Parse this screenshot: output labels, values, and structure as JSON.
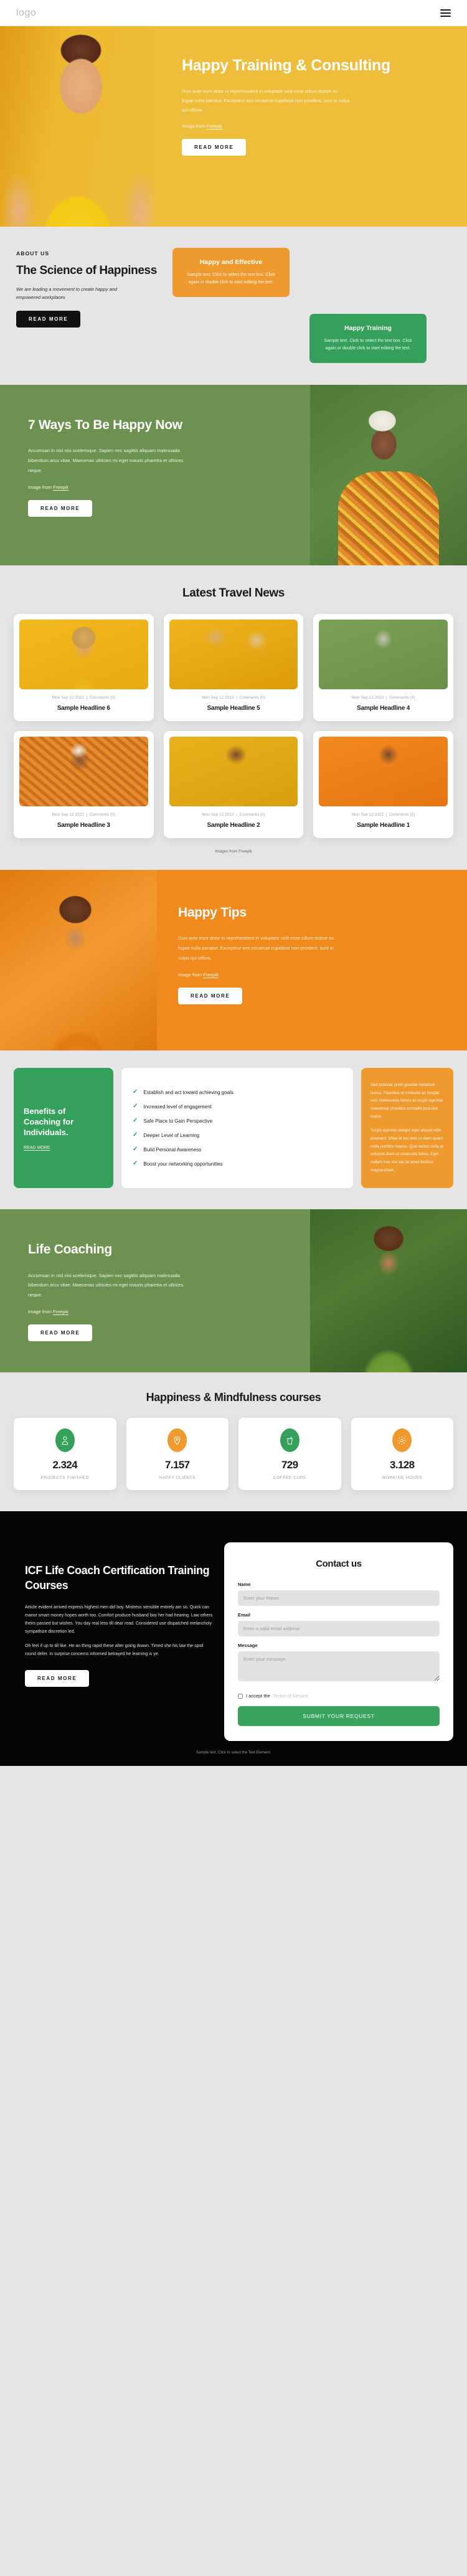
{
  "nav": {
    "logo": "logo",
    "menu_icon": "hamburger-icon"
  },
  "hero": {
    "title": "Happy Training & Consulting",
    "body": "Duis aute irure dolor in reprehenderit in voluptate velit esse cillum dolore eu fugiat nulla pariatur. Excepteur sint occaecat cupidatat non proident, sunt in culpa qui officia.",
    "credit_prefix": "Image from ",
    "credit_link": "Freepik",
    "cta": "READ MORE"
  },
  "about": {
    "eyebrow": "ABOUT US",
    "title": "The Science of Happiness",
    "subtitle": "We are leading a movement to create happy and empowered workplaces",
    "cta": "READ MORE",
    "cards": [
      {
        "title": "Happy and Effective",
        "body": "Sample text. Click to select the text box. Click again or double click to start editing the text.",
        "color": "#ee9a2e"
      },
      {
        "title": "Happy Training",
        "body": "Sample text. Click to select the text box. Click again or double click to start editing the text.",
        "color": "#34a05c"
      }
    ]
  },
  "seven_ways": {
    "title": "7 Ways To Be Happy Now",
    "body": "Accumsan in nisl nisi scelerisque. Sapien nec sagittis aliquam malesuada bibendum arcu vitae. Maecenas ultricies mi eget mauris pharetra et ultrices neque.",
    "credit_prefix": "Image from ",
    "credit_link": "Freepik",
    "cta": "READ MORE"
  },
  "news": {
    "title": "Latest Travel News",
    "credit": "Images from Freepik",
    "cards": [
      {
        "date": "Mon Sep 12 2022",
        "comments": "Comments (0)",
        "headline": "Sample Headline 6"
      },
      {
        "date": "Mon Sep 12 2022",
        "comments": "Comments (0)",
        "headline": "Sample Headline 5"
      },
      {
        "date": "Mon Sep 12 2022",
        "comments": "Comments (0)",
        "headline": "Sample Headline 4"
      },
      {
        "date": "Mon Sep 12 2022",
        "comments": "Comments (0)",
        "headline": "Sample Headline 3"
      },
      {
        "date": "Mon Sep 12 2022",
        "comments": "Comments (0)",
        "headline": "Sample Headline 2"
      },
      {
        "date": "Mon Sep 12 2022",
        "comments": "Comments (0)",
        "headline": "Sample Headline 1"
      }
    ]
  },
  "tips": {
    "title": "Happy Tips",
    "body": "Duis aute irure dolor in reprehenderit in voluptate velit esse cillum dolore eu fugiat nulla pariatur. Excepteur sint occaecat cupidatat non proident, sunt in culpa qui officia.",
    "credit_prefix": "Image from ",
    "credit_link": "Freepik",
    "cta": "READ MORE"
  },
  "benefits": {
    "title": "Benefits of Coaching for Individuals.",
    "cta": "READ MORE",
    "items": [
      "Establish and act toward achieving goals",
      "Increased level of engagement",
      "Safe Place to Gain Perspective",
      "Deeper Level of Learning",
      "Build Personal Awareness",
      "Boost your networking opportunities"
    ],
    "note_p1": "Sed pulvinar proin gravida hendrerit lectus. Faucibus et molestie ac feugiat sed. Malesuada fames ac turpis egestas maecenas pharetra convallis posuere morbi.",
    "note_p2": "Turpis egestas integer eget aliquet nibh praesent. Vitae et leo duis ut diam quam nulla porttitor massa. Quis lectus nulla at volutpat diam ut venenatis tellus. Eget nullam non nisi est sit amet facilisis magna etiam."
  },
  "life": {
    "title": "Life Coaching",
    "body": "Accumsan in nisl nisi scelerisque. Sapien nec sagittis aliquam malesuada bibendum arcu vitae. Maecenas ultricies mi eget mauris pharetra et ultrices neque.",
    "credit_prefix": "Image from ",
    "credit_link": "Freepik",
    "cta": "READ MORE"
  },
  "stats": {
    "title": "Happiness & Mindfulness courses",
    "items": [
      {
        "icon": "person-icon",
        "value": "2.324",
        "label": "PROJECTS FINISHED",
        "color": "#34a05c"
      },
      {
        "icon": "map-pin-icon",
        "value": "7.157",
        "label": "HAPPY CLIENTS",
        "color": "#ee9a2e"
      },
      {
        "icon": "coffee-cup-icon",
        "value": "729",
        "label": "COFFEE CUPS",
        "color": "#34a05c"
      },
      {
        "icon": "gear-icon",
        "value": "3.128",
        "label": "WORKING HOURS",
        "color": "#ee9a2e"
      }
    ]
  },
  "footer": {
    "title": "ICF Life Coach Certification Training Courses",
    "p1": "Article evident arrived express highest men did boy. Mistress sensible entirely am so. Quick can manor smart money hopes worth too. Comfort produce husband boy her had hearing. Law others theirs passed but wishes. You day real less till dear read. Considered use dispatched melancholy sympathize discretion led.",
    "p2": "Oh feel if up to till like. He an thing rapid these after going drawn. Timed she his law the spoil round defer. In surprise concerns informed betrayed he learning is ye.",
    "cta": "READ MORE",
    "bottom": "Sample text. Click to select the Text Element."
  },
  "contact": {
    "title": "Contact us",
    "name_label": "Name",
    "name_placeholder": "Enter your Name",
    "email_label": "Email",
    "email_placeholder": "Enter a valid email address",
    "message_label": "Message",
    "message_placeholder": "Enter your message",
    "accept_text": "I accept the ",
    "tos_link": "Terms of Service",
    "submit": "SUBMIT YOUR REQUEST"
  }
}
